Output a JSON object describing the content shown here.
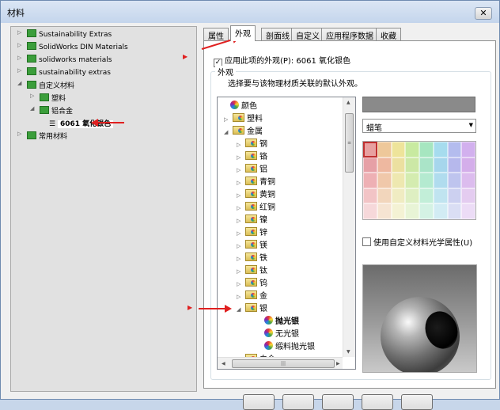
{
  "window": {
    "title": "材料",
    "close_label": "✕"
  },
  "left_tree": {
    "items": [
      {
        "label": "Sustainability Extras",
        "expander": "▷"
      },
      {
        "label": "SolidWorks DIN Materials",
        "expander": "▷"
      },
      {
        "label": "solidworks materials",
        "expander": "▷"
      },
      {
        "label": "sustainability extras",
        "expander": "▷"
      },
      {
        "label": "自定义材料",
        "expander": "◢"
      },
      {
        "label": "塑料",
        "expander": "▷"
      },
      {
        "label": "铝合金",
        "expander": "◢"
      },
      {
        "label": "6061 氧化银色",
        "selected": true
      },
      {
        "label": "常用材料",
        "expander": "▷"
      }
    ]
  },
  "tabs": [
    {
      "label": "属性",
      "active": false
    },
    {
      "label": "外观",
      "active": true
    },
    {
      "label": "剖面线",
      "active": false
    },
    {
      "label": "自定义",
      "active": false
    },
    {
      "label": "应用程序数据",
      "active": false
    },
    {
      "label": "收藏",
      "active": false
    }
  ],
  "appearance": {
    "apply_checkbox_label": "应用此项的外观(P): 6061 氧化银色",
    "apply_checked": true,
    "group_label": "外观",
    "description": "选择要与该物理材质关联的默认外观。",
    "tree": [
      {
        "label": "颜色",
        "kind": "ball"
      },
      {
        "label": "塑料",
        "kind": "folder",
        "expander": "▷"
      },
      {
        "label": "金属",
        "kind": "folder",
        "expander": "◢"
      },
      {
        "label": "钢",
        "kind": "folder",
        "expander": "▷"
      },
      {
        "label": "铬",
        "kind": "folder",
        "expander": "▷"
      },
      {
        "label": "铝",
        "kind": "folder",
        "expander": "▷"
      },
      {
        "label": "青铜",
        "kind": "folder",
        "expander": "▷"
      },
      {
        "label": "黄铜",
        "kind": "folder",
        "expander": "▷"
      },
      {
        "label": "红铜",
        "kind": "folder",
        "expander": "▷"
      },
      {
        "label": "镍",
        "kind": "folder",
        "expander": "▷"
      },
      {
        "label": "锌",
        "kind": "folder",
        "expander": "▷"
      },
      {
        "label": "镁",
        "kind": "folder",
        "expander": "▷"
      },
      {
        "label": "铁",
        "kind": "folder",
        "expander": "▷"
      },
      {
        "label": "钛",
        "kind": "folder",
        "expander": "▷"
      },
      {
        "label": "钨",
        "kind": "folder",
        "expander": "▷"
      },
      {
        "label": "金",
        "kind": "folder",
        "expander": "▷"
      },
      {
        "label": "银",
        "kind": "folder",
        "expander": "◢"
      },
      {
        "label": "抛光银",
        "kind": "ball",
        "bold": true
      },
      {
        "label": "无光银",
        "kind": "ball"
      },
      {
        "label": "缎料抛光银",
        "kind": "ball"
      },
      {
        "label": "白金",
        "kind": "folder",
        "expander": "▷"
      }
    ],
    "color_swatch": "#8a8a8a",
    "brush_combo_value": "蜡笔",
    "custom_optics_label": "使用自定义材料光学属性(U)",
    "custom_optics_checked": false,
    "palette_colors": [
      "#e8a0a0",
      "#eec89a",
      "#eee49a",
      "#c8eaa0",
      "#a6e6c0",
      "#a6dcee",
      "#b4bcee",
      "#d2b0ee",
      "#e6a0a6",
      "#eeb8a0",
      "#ece0a0",
      "#cce8a6",
      "#aae4c8",
      "#a6d6ec",
      "#b6b8ec",
      "#d4aeea",
      "#eeb0b4",
      "#f0c8aa",
      "#eee8b0",
      "#d4ecb0",
      "#b4ead0",
      "#b0dcee",
      "#bec4ee",
      "#dcbcee",
      "#f2c4c6",
      "#f2d6bc",
      "#f0ecc2",
      "#deefc2",
      "#c2eed8",
      "#c0e4f0",
      "#ccd0f0",
      "#e4ccf0",
      "#f6d8da",
      "#f6e4d2",
      "#f4f2d4",
      "#e8f4d6",
      "#d4f2e4",
      "#d2ecf4",
      "#dadef4",
      "#ecdcf6"
    ]
  },
  "annotations": {
    "accent_color": "#e02020"
  }
}
